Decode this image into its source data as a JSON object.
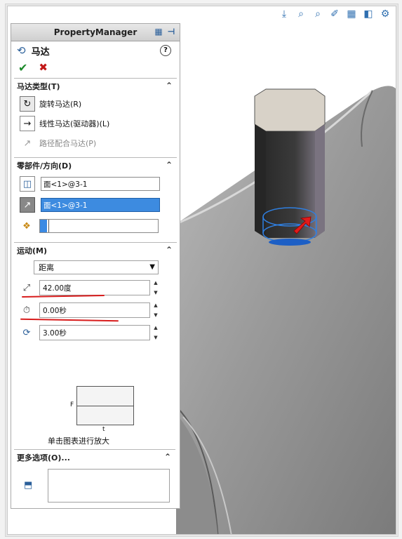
{
  "panel": {
    "title": "PropertyManager",
    "feature_title": "马达"
  },
  "sections": {
    "motor_type": {
      "header": "马达类型(T)",
      "options": [
        {
          "label": "旋转马达(R)",
          "icon": "rotary-motor-icon",
          "selected": true
        },
        {
          "label": "线性马达(驱动器)(L)",
          "icon": "linear-motor-icon",
          "selected": false
        },
        {
          "label": "路径配合马达(P)",
          "icon": "path-mate-motor-icon",
          "selected": false
        }
      ]
    },
    "component_direction": {
      "header": "零部件/方向(D)",
      "motor_location_value": "面<1>@3-1",
      "motor_direction_value": "面<1>@3-1",
      "component_to_move_value": ""
    },
    "motion": {
      "header": "运动(M)",
      "motion_type": "距离",
      "displacement": "42.00度",
      "start_time": "0.00秒",
      "duration": "3.00秒",
      "graph_ylabel": "F",
      "graph_xlabel": "t",
      "graph_caption": "单击图表进行放大"
    },
    "more_options": {
      "header": "更多选项(O)..."
    }
  },
  "colors": {
    "accent": "#3d8be0",
    "ok": "#1c8a2a",
    "cancel": "#c21818",
    "annotation": "#d81d1d"
  }
}
